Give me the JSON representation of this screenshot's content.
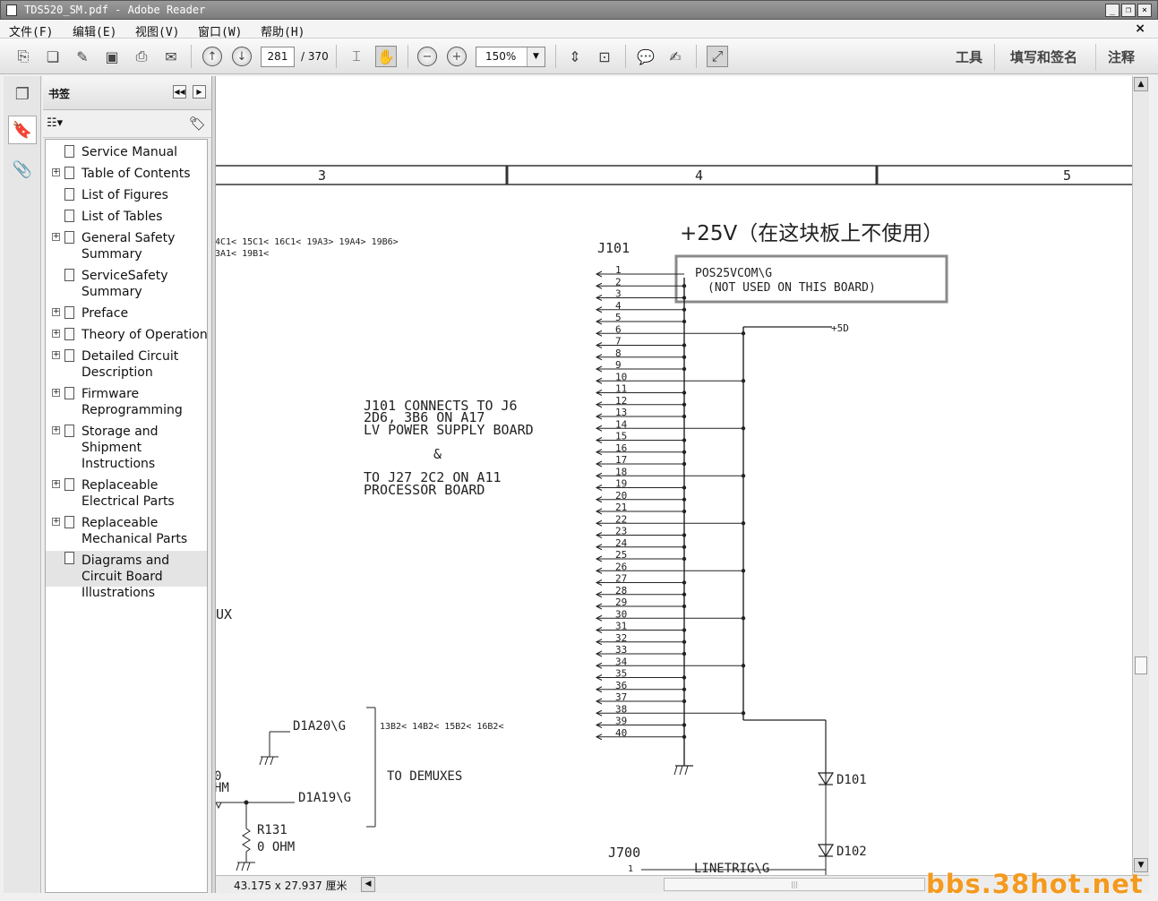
{
  "window": {
    "title": "TDS520_SM.pdf - Adobe Reader"
  },
  "menu": [
    "文件(F)",
    "编辑(E)",
    "视图(V)",
    "窗口(W)",
    "帮助(H)"
  ],
  "toolbar": {
    "page_current": "281",
    "page_total": "/ 370",
    "zoom": "150%",
    "right_tabs": [
      "工具",
      "填写和签名",
      "注释"
    ]
  },
  "bookmarks": {
    "title": "书签",
    "items": [
      {
        "label": "Service Manual",
        "expandable": false
      },
      {
        "label": "Table of Contents",
        "expandable": true
      },
      {
        "label": "List of Figures",
        "expandable": false
      },
      {
        "label": "List of Tables",
        "expandable": false
      },
      {
        "label": "General Safety Summary",
        "expandable": true
      },
      {
        "label": "ServiceSafety Summary",
        "expandable": false
      },
      {
        "label": "Preface",
        "expandable": true
      },
      {
        "label": "Theory of Operation",
        "expandable": true
      },
      {
        "label": "Detailed Circuit Description",
        "expandable": true
      },
      {
        "label": "Firmware Reprogramming",
        "expandable": true
      },
      {
        "label": "Storage and Shipment Instructions",
        "expandable": true
      },
      {
        "label": "Replaceable Electrical Parts",
        "expandable": true
      },
      {
        "label": "Replaceable Mechanical Parts",
        "expandable": true
      },
      {
        "label": "Diagrams and Circuit Board Illustrations",
        "expandable": false,
        "selected": true
      }
    ]
  },
  "schematic": {
    "zones": [
      "3",
      "4",
      "5"
    ],
    "annotation": "+25V（在这块板上不使用）",
    "connector": "J101",
    "pin1_net": "POS25VCOM\\G",
    "pin1_note": "(NOT USED ON THIS BOARD)",
    "net_5d": "+5D",
    "xref_top_1": "4C1< 15C1< 16C1< 19A3> 19A4> 19B6>",
    "xref_top_2": "3A1< 19B1<",
    "note_lines": [
      "J101 CONNECTS TO J6",
      "2D6, 3B6 ON A17",
      "LV POWER SUPPLY BOARD",
      "&",
      "TO J27 2C2 ON A11",
      "PROCESSOR BOARD"
    ],
    "mux_label": "UX",
    "net_d1a20": "D1A20\\G",
    "net_d1a19": "D1A19\\G",
    "xref_bottom": "13B2< 14B2< 15B2< 16B2<",
    "to_demuxes": "TO DEMUXES",
    "ohm_fragment_1": "0",
    "ohm_fragment_2": "HM",
    "resistor": "R131",
    "resistor_value": "0 OHM",
    "diode1": "D101",
    "diode2": "D102",
    "connector2": "J700",
    "linetrig": "LINETRIG\\G",
    "j700_pin": "1"
  },
  "status": {
    "page_size": "43.175 x 27.937 厘米"
  },
  "watermark": "bbs.38hot.net"
}
